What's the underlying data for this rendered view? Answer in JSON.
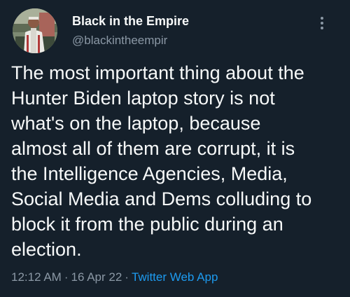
{
  "author": {
    "name": "Black in the Empire",
    "handle": "@blackintheempir"
  },
  "tweet": {
    "lines": [
      "The most important thing about the",
      "Hunter Biden laptop story is not",
      "what's on the laptop, because",
      "almost all of them are corrupt, it is",
      "the Intelligence Agencies, Media,",
      "Social Media and Dems colluding to",
      "block it from the public during an",
      "election."
    ]
  },
  "meta": {
    "time": "12:12 AM",
    "separator": "·",
    "date": "16 Apr 22",
    "source": "Twitter Web App"
  },
  "colors": {
    "background": "#15202b",
    "text": "#f7f9f9",
    "secondary": "#8b98a5",
    "accent": "#1d9bf0"
  },
  "icons": {
    "more": "more-vertical-icon"
  }
}
